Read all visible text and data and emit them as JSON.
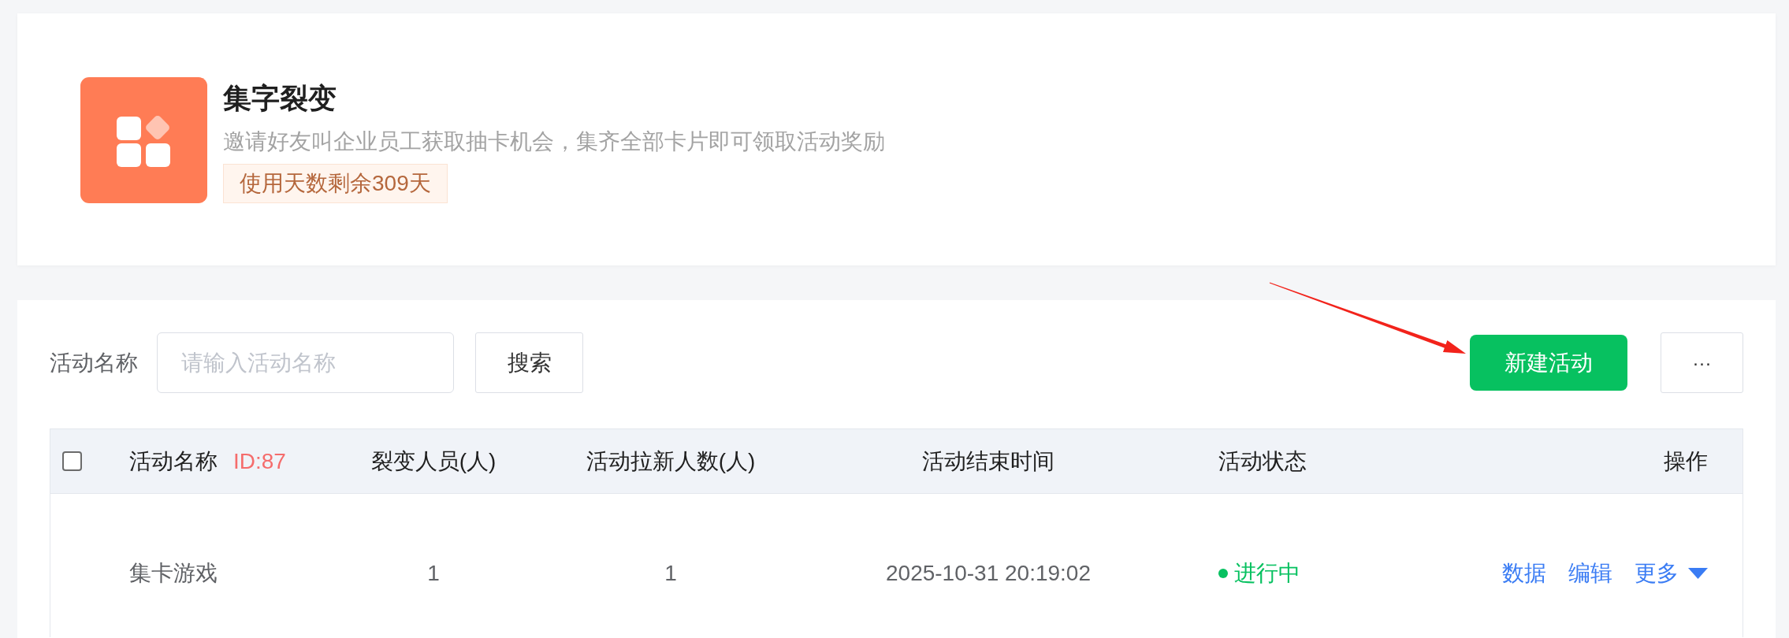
{
  "app": {
    "title": "集字裂变",
    "description": "邀请好友叫企业员工获取抽卡机会，集齐全部卡片即可领取活动奖励",
    "remaining_badge": "使用天数剩余309天"
  },
  "filter": {
    "label": "活动名称",
    "search_field": {
      "placeholder": "请输入活动名称"
    },
    "search_button": "搜索",
    "new_button": "新建活动",
    "more_button": "···"
  },
  "table": {
    "select_all": {
      "checked": false
    },
    "columns": [
      {
        "label": "活动名称",
        "id_tag": "ID:87"
      },
      {
        "label": "裂变人员(人)"
      },
      {
        "label": "活动拉新人数(人)"
      },
      {
        "label": "活动结束时间"
      },
      {
        "label": "活动状态"
      },
      {
        "label": "操作"
      }
    ],
    "rows": [
      {
        "name": "集卡游戏",
        "members": "1",
        "new_users": "1",
        "end_time": "2025-10-31 20:19:02",
        "status": {
          "label": "进行中",
          "color": "#07c160"
        },
        "actions": [
          {
            "label": "数据",
            "kind": "link"
          },
          {
            "label": "编辑",
            "kind": "link"
          },
          {
            "label": "更多",
            "kind": "dropdown"
          }
        ]
      }
    ]
  }
}
